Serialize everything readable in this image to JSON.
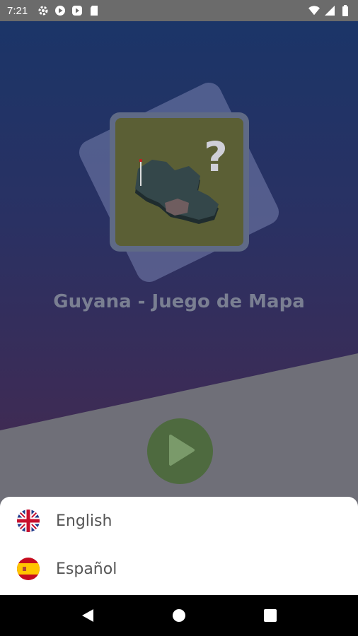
{
  "status_bar": {
    "time": "7:21",
    "left_icons": [
      "gear-icon",
      "play-store-icon",
      "media-icon",
      "sd-card-icon"
    ],
    "right_icons": [
      "wifi-icon",
      "signal-icon",
      "battery-icon"
    ]
  },
  "app": {
    "title": "Guyana - Juego de Mapa",
    "logo_symbol": "?",
    "play_icon": "play-icon"
  },
  "language_sheet": {
    "items": [
      {
        "label": "English",
        "flag": "uk-flag-icon"
      },
      {
        "label": "Español",
        "flag": "spain-flag-icon"
      }
    ]
  },
  "nav_bar": {
    "buttons": [
      "back-icon",
      "home-icon",
      "recents-icon"
    ]
  },
  "colors": {
    "bg_top": "#1b3568",
    "bg_bottom": "#4e2746",
    "sheet_bg": "#ffffff",
    "play_green": "#4e6a3f"
  }
}
